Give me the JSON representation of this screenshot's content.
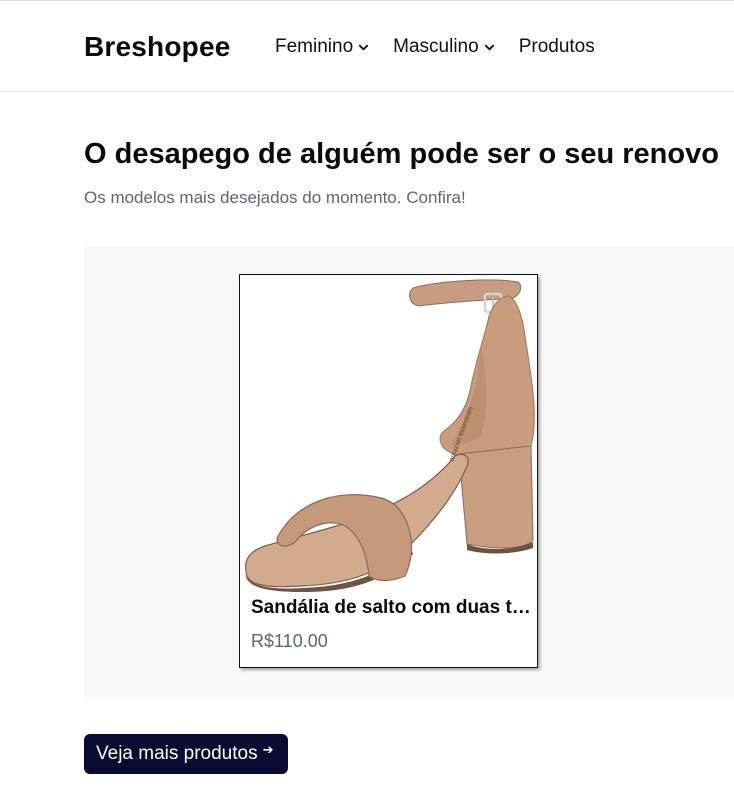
{
  "header": {
    "brand": "Breshopee",
    "nav": [
      {
        "label": "Feminino",
        "has_dropdown": true,
        "icon": "chevron-down-icon"
      },
      {
        "label": "Masculino",
        "has_dropdown": true,
        "icon": "chevron-down-icon"
      },
      {
        "label": "Produtos",
        "has_dropdown": false
      }
    ]
  },
  "hero": {
    "title": "O desapego de alguém pode ser o seu renovo",
    "subtitle": "Os modelos mais desejados do momento. Confira!"
  },
  "products": [
    {
      "title": "Sandália de salto com duas tiras",
      "price": "R$110.00",
      "image_icon": "sandal-image"
    }
  ],
  "cta": {
    "label": "Veja mais produtos",
    "icon": "arrow-right-icon",
    "color": "#0b0a33"
  },
  "colors": {
    "text_primary": "#0b0b0b",
    "text_muted": "#5e6677",
    "carousel_bg": "#f8f8f8"
  }
}
